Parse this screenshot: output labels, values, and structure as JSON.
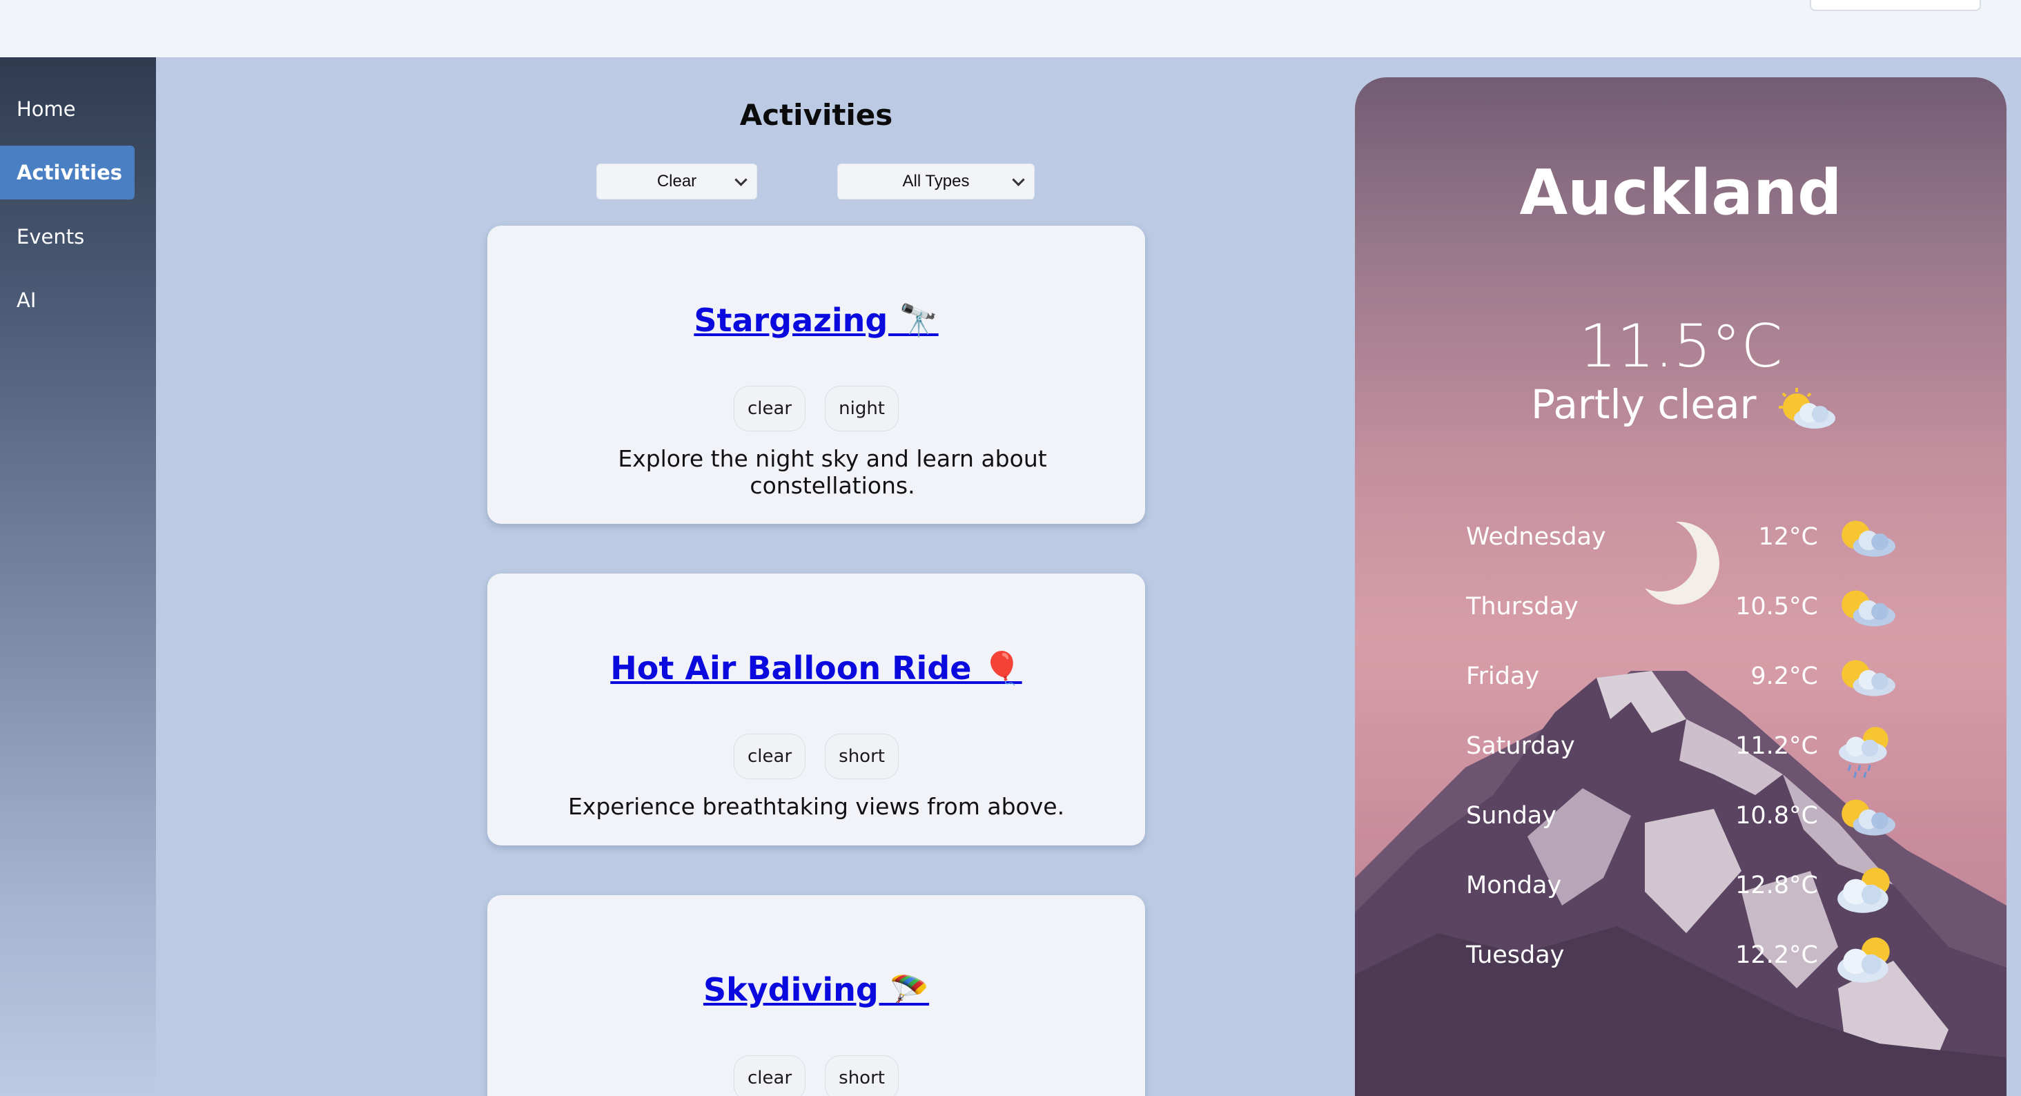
{
  "sidebar": {
    "items": [
      {
        "label": "Home",
        "active": false
      },
      {
        "label": "Activities",
        "active": true
      },
      {
        "label": "Events",
        "active": false
      },
      {
        "label": "AI",
        "active": false
      }
    ]
  },
  "main": {
    "title": "Activities",
    "filters": {
      "weather_selected": "Clear",
      "type_selected": "All Types"
    },
    "cards": [
      {
        "title": "Stargazing 🔭",
        "tags": [
          "clear",
          "night"
        ],
        "description": "Explore the night sky and learn about constellations."
      },
      {
        "title": "Hot Air Balloon Ride 🎈",
        "tags": [
          "clear",
          "short"
        ],
        "description": "Experience breathtaking views from above."
      },
      {
        "title": "Skydiving 🪂",
        "tags": [
          "clear",
          "short"
        ],
        "description": ""
      }
    ]
  },
  "weather": {
    "city": "Auckland",
    "current_temp": "11.5°C",
    "current_condition": "Partly clear",
    "current_icon": "sun-behind-cloud-icon",
    "forecast": [
      {
        "day": "Wednesday",
        "temp": "12°C",
        "icon": "sun-behind-cloud-icon"
      },
      {
        "day": "Thursday",
        "temp": "10.5°C",
        "icon": "sun-behind-cloud-icon"
      },
      {
        "day": "Friday",
        "temp": "9.2°C",
        "icon": "sun-behind-cloud-icon"
      },
      {
        "day": "Saturday",
        "temp": "11.2°C",
        "icon": "sun-cloud-rain-icon"
      },
      {
        "day": "Sunday",
        "temp": "10.8°C",
        "icon": "sun-behind-cloud-icon"
      },
      {
        "day": "Monday",
        "temp": "12.8°C",
        "icon": "cloud-sun-icon"
      },
      {
        "day": "Tuesday",
        "temp": "12.2°C",
        "icon": "cloud-sun-icon"
      }
    ]
  }
}
